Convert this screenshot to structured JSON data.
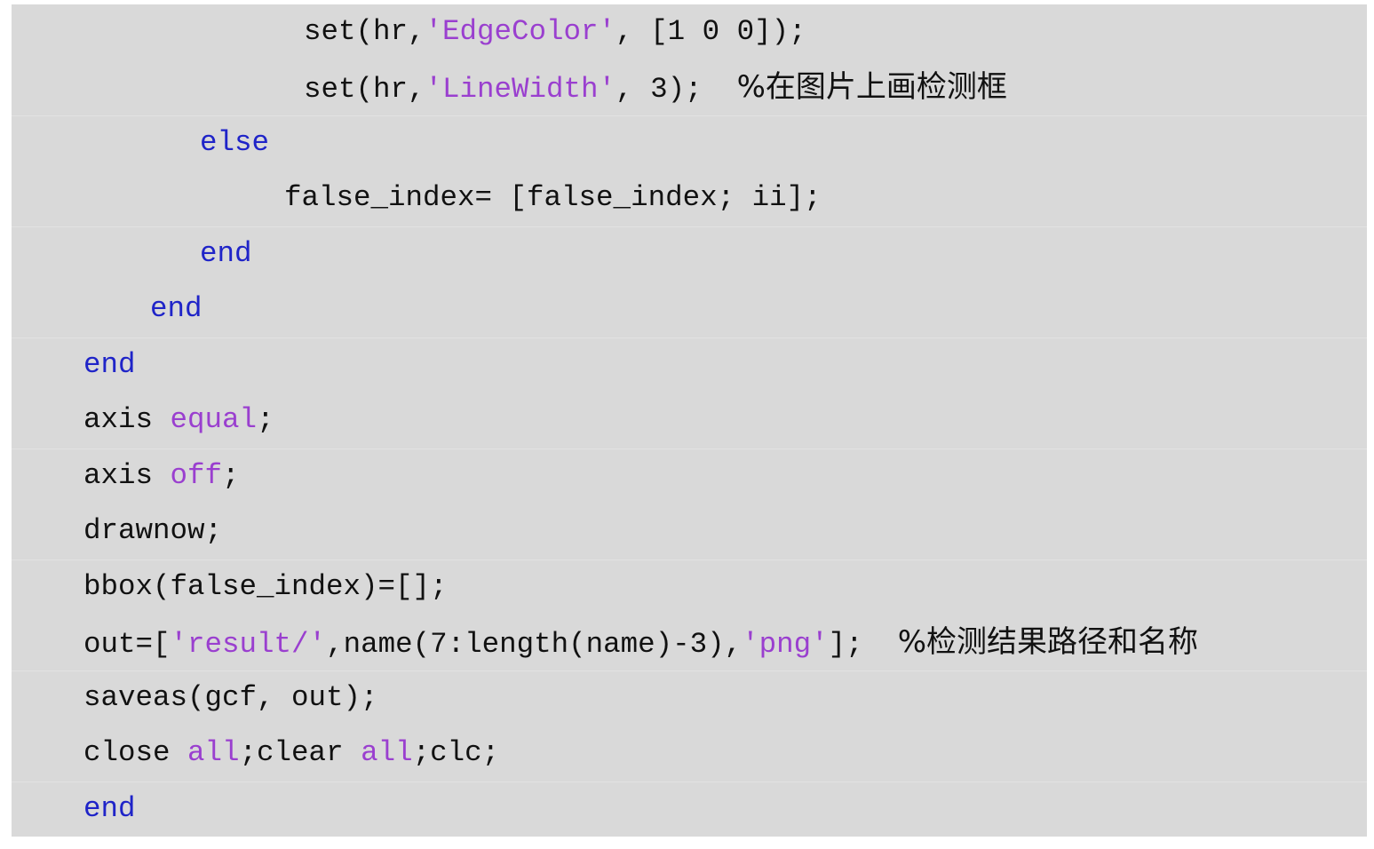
{
  "colors": {
    "background": "#d9d9d9",
    "keyword": "#1f24c8",
    "string": "#9a3fcf",
    "text": "#111111"
  },
  "lines": [
    [
      {
        "t": "set(hr,",
        "c": ""
      },
      {
        "t": "'EdgeColor'",
        "c": "str"
      },
      {
        "t": ", [1 0 0]);",
        "c": ""
      }
    ],
    [
      {
        "t": "set(hr,",
        "c": ""
      },
      {
        "t": "'LineWidth'",
        "c": "str"
      },
      {
        "t": ", 3);  ",
        "c": ""
      },
      {
        "t": "%在图片上画检测框",
        "c": "cm"
      }
    ],
    [
      {
        "t": "else",
        "c": "kw"
      }
    ],
    [
      {
        "t": "false_index= [false_index; ii];",
        "c": ""
      }
    ],
    [
      {
        "t": "end",
        "c": "kw"
      }
    ],
    [
      {
        "t": "end",
        "c": "kw"
      }
    ],
    [
      {
        "t": "end",
        "c": "kw"
      }
    ],
    [
      {
        "t": "axis ",
        "c": ""
      },
      {
        "t": "equal",
        "c": "str"
      },
      {
        "t": ";",
        "c": ""
      }
    ],
    [
      {
        "t": "axis ",
        "c": ""
      },
      {
        "t": "off",
        "c": "str"
      },
      {
        "t": ";",
        "c": ""
      }
    ],
    [
      {
        "t": "drawnow;",
        "c": ""
      }
    ],
    [
      {
        "t": "bbox(false_index)=[];",
        "c": ""
      }
    ],
    [
      {
        "t": "out=[",
        "c": ""
      },
      {
        "t": "'result/'",
        "c": "str"
      },
      {
        "t": ",name(7:length(name)-3),",
        "c": ""
      },
      {
        "t": "'png'",
        "c": "str"
      },
      {
        "t": "];  ",
        "c": ""
      },
      {
        "t": "%检测结果路径和名称",
        "c": "cm"
      }
    ],
    [
      {
        "t": "saveas(gcf, out);",
        "c": ""
      }
    ],
    [
      {
        "t": "close ",
        "c": ""
      },
      {
        "t": "all",
        "c": "str"
      },
      {
        "t": ";clear ",
        "c": ""
      },
      {
        "t": "all",
        "c": "str"
      },
      {
        "t": ";clc;",
        "c": ""
      }
    ],
    [
      {
        "t": "end",
        "c": "kw"
      }
    ]
  ]
}
